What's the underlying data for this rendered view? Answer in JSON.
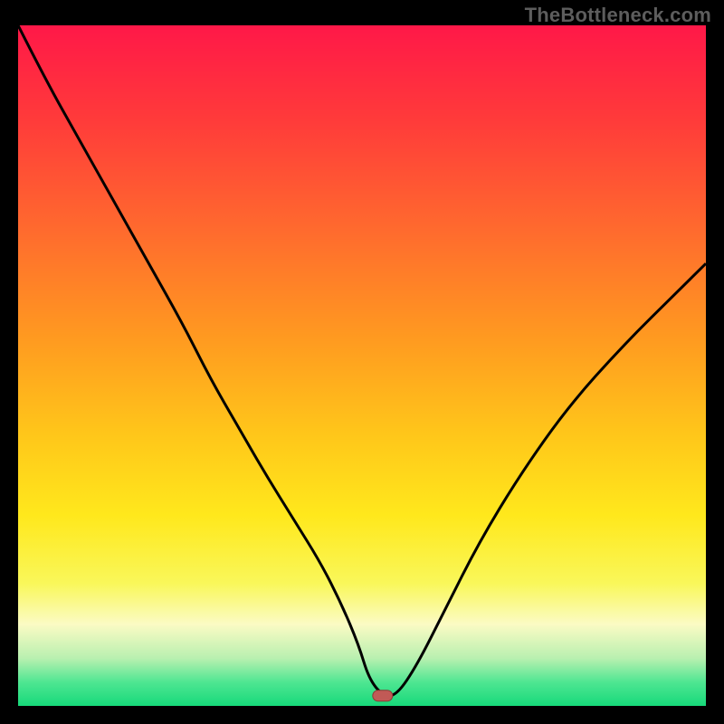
{
  "watermark": "TheBottleneck.com",
  "colors": {
    "frame_bg": "#000000",
    "watermark_text": "#5d5d5d",
    "curve": "#000000",
    "marker_fill": "#c15a56",
    "marker_stroke": "#8b3b37",
    "gradient_stops": [
      {
        "offset": 0.0,
        "color": "#ff1848"
      },
      {
        "offset": 0.14,
        "color": "#ff3b3a"
      },
      {
        "offset": 0.3,
        "color": "#ff6a2e"
      },
      {
        "offset": 0.46,
        "color": "#ff9a20"
      },
      {
        "offset": 0.6,
        "color": "#ffc61a"
      },
      {
        "offset": 0.72,
        "color": "#ffe81c"
      },
      {
        "offset": 0.82,
        "color": "#f9f75a"
      },
      {
        "offset": 0.88,
        "color": "#fbfbc4"
      },
      {
        "offset": 0.93,
        "color": "#b9f0b0"
      },
      {
        "offset": 0.965,
        "color": "#4fe692"
      },
      {
        "offset": 1.0,
        "color": "#17d97a"
      }
    ]
  },
  "chart_data": {
    "type": "line",
    "title": "",
    "xlabel": "",
    "ylabel": "",
    "xlim": [
      0,
      100
    ],
    "ylim": [
      0,
      100
    ],
    "grid": false,
    "legend": false,
    "marker": {
      "x": 53,
      "y": 1.5
    },
    "series": [
      {
        "name": "curve",
        "x": [
          0,
          4,
          9,
          14,
          19,
          24,
          28,
          32,
          36,
          40,
          44,
          47,
          49.5,
          51,
          53,
          55,
          58,
          62,
          67,
          73,
          80,
          88,
          96,
          100
        ],
        "values": [
          100,
          92,
          83,
          74,
          65,
          56,
          48,
          41,
          34,
          27.5,
          21,
          15,
          9,
          4,
          1.5,
          1.5,
          6,
          14,
          24,
          34,
          44,
          53,
          61,
          65
        ]
      }
    ]
  }
}
